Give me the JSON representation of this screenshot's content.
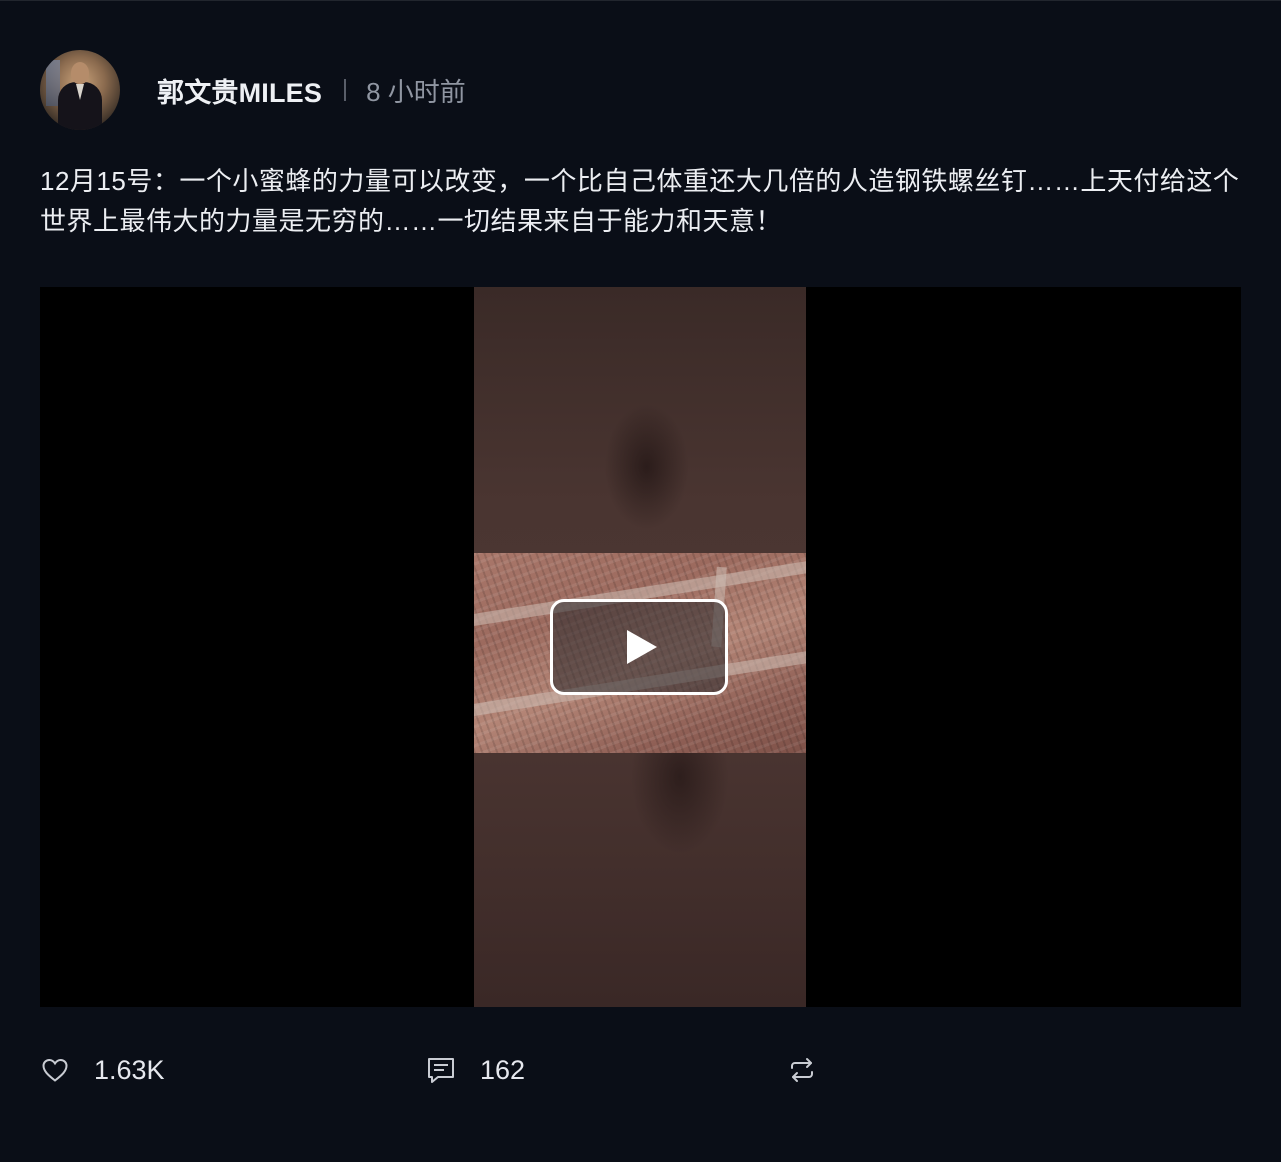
{
  "post": {
    "author": "郭文贵MILES",
    "time": "8 小时前",
    "text": "12月15号：一个小蜜蜂的力量可以改变，一个比自己体重还大几倍的人造钢铁螺丝钉……上天付给这个世界上最伟大的力量是无穷的……一切结果来自于能力和天意！"
  },
  "video": {
    "play_icon": "play-icon"
  },
  "actions": {
    "likes": "1.63K",
    "comments": "162",
    "like_icon": "heart-icon",
    "comment_icon": "comment-icon",
    "share_icon": "repost-icon"
  },
  "colors": {
    "background": "#0a0e17",
    "text": "#eceef2",
    "muted": "#9096a2"
  }
}
